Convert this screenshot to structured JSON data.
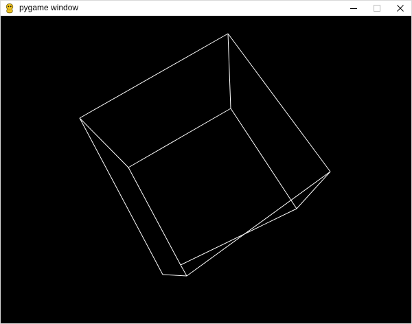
{
  "window": {
    "title": "pygame window",
    "app_icon": "pygame-snake-icon",
    "controls": {
      "minimize_icon": "minimize-icon",
      "maximize_icon": "maximize-icon",
      "close_icon": "close-icon"
    }
  },
  "scene": {
    "background": "#000000",
    "line_color": "#ffffff",
    "object": "wireframe-cube"
  }
}
